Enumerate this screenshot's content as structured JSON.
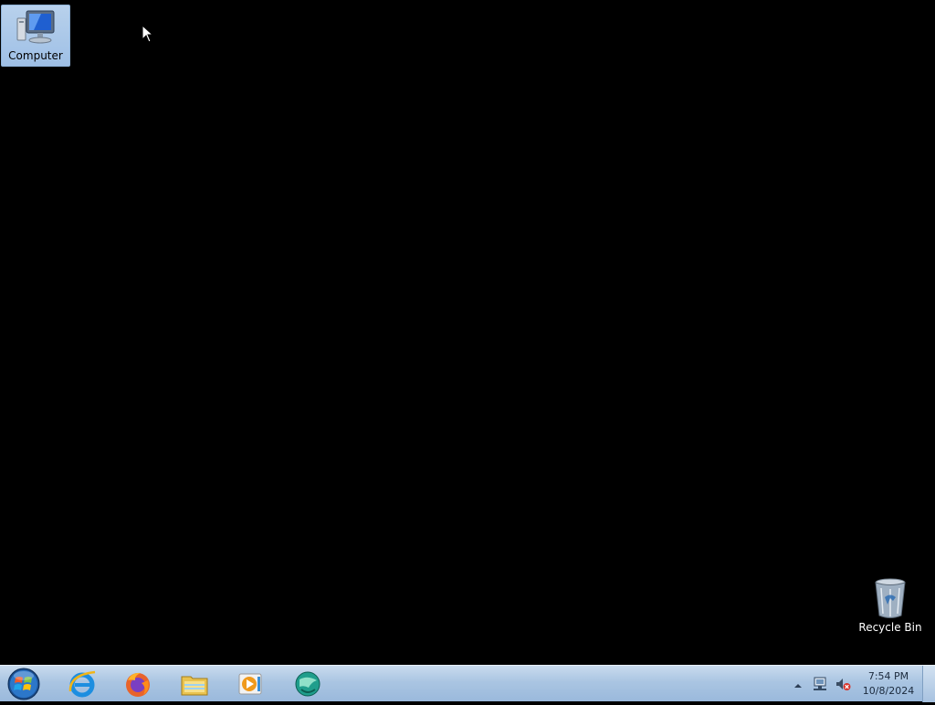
{
  "desktop": {
    "background_color": "#000000",
    "icons": [
      {
        "label": "Computer",
        "icon": "computer-icon",
        "selected": true
      },
      {
        "label": "Recycle Bin",
        "icon": "recycle-bin-icon",
        "selected": false
      }
    ]
  },
  "taskbar": {
    "start_button": {
      "icon": "windows-start-orb-icon"
    },
    "pinned": [
      {
        "icon": "internet-explorer-icon"
      },
      {
        "icon": "firefox-icon"
      },
      {
        "icon": "file-explorer-icon"
      },
      {
        "icon": "media-player-icon"
      },
      {
        "icon": "app-globe-icon"
      }
    ],
    "tray": {
      "show_hidden_icon": "chevron-up-icon",
      "network_icon": "network-icon",
      "volume_icon": "volume-muted-icon"
    },
    "clock": {
      "time": "7:54 PM",
      "date": "10/8/2024"
    }
  }
}
